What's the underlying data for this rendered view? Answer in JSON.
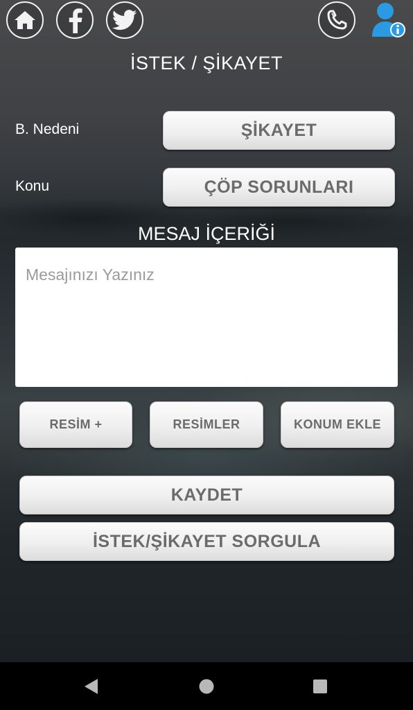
{
  "page_title": "İSTEK / ŞİKAYET",
  "fields": {
    "reason_label": "B. Nedeni",
    "reason_value": "ŞİKAYET",
    "topic_label": "Konu",
    "topic_value": "ÇÖP SORUNLARI"
  },
  "message": {
    "title": "MESAJ İÇERİĞİ",
    "placeholder": "Mesajınızı Yazınız",
    "value": ""
  },
  "actions": {
    "add_image": "RESİM +",
    "images": "RESİMLER",
    "add_location": "KONUM EKLE",
    "save": "KAYDET",
    "query": "İSTEK/ŞİKAYET SORGULA"
  },
  "icons": {
    "home": "home-icon",
    "facebook": "facebook-icon",
    "twitter": "twitter-icon",
    "phone": "phone-icon",
    "user_info": "user-info-icon",
    "nav_back": "back-triangle-icon",
    "nav_home": "home-circle-icon",
    "nav_recents": "recents-square-icon"
  },
  "colors": {
    "button_text": "#6b6b6b",
    "user_icon": "#2a9be3",
    "text_light": "#ffffff",
    "placeholder": "#9a9a9a"
  }
}
